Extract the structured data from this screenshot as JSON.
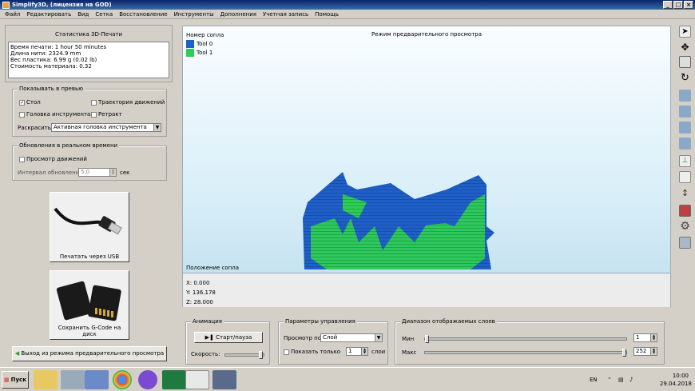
{
  "window": {
    "title": "Simplify3D, (лицензия на GOD)",
    "buttons": [
      "_",
      "□",
      "×"
    ]
  },
  "menu": [
    "Файл",
    "Редактировать",
    "Вид",
    "Сетка",
    "Восстановление",
    "Инструменты",
    "Дополнения",
    "Учетная запись",
    "Помощь"
  ],
  "stats": {
    "title": "Статистика 3D-Печати",
    "lines": [
      "Время печати: 1 hour 50 minutes",
      "Длина нити: 2324.9 mm",
      "Вес пластика: 6.99 g (0.02 lb)",
      "Стоимость материала: 0.32"
    ]
  },
  "show_in_preview": {
    "title": "Показывать в превью",
    "bed": "Стол",
    "travel": "Траектория движений",
    "toolhead": "Головка инструмента",
    "retract": "Ретракт",
    "color_label": "Раскрасить",
    "color_value": "Активная головка инструмента"
  },
  "realtime": {
    "title": "Обновления в реальном времени",
    "movement": "Просмотр движений",
    "interval_label": "Интервал обновления",
    "interval_value": "5,0",
    "interval_unit": "сек"
  },
  "print_usb": "Печатать через USB",
  "save_gcode": "Сохранить G-Code на диск",
  "exit_preview": "Выход из режима предварительного просмотра",
  "viewport": {
    "legend_title": "Номер сопла",
    "legend": [
      {
        "name": "Tool 0",
        "color": "#1f5fc8"
      },
      {
        "name": "Tool 1",
        "color": "#2ecc55"
      }
    ],
    "mode": "Режим предварительного просмотра",
    "nozzle_pos": "Положение сопла"
  },
  "coords": {
    "x": "X: 0.000",
    "y": "Y: 136.178",
    "z": "Z: 28.000"
  },
  "animation": {
    "title": "Анимация",
    "play": "Старт/пауза",
    "speed": "Скорость:",
    "speed_level": 1.0
  },
  "control": {
    "title": "Параметры управления",
    "view_by": "Просмотр по",
    "view_by_value": "Слой",
    "only": "Показать только",
    "only_value": "1",
    "layers": "слои"
  },
  "layer_range": {
    "title": "Диапазон отображаемых слоев",
    "min_label": "Мин",
    "min_value": "1",
    "max_label": "Макс",
    "max_value": "252"
  },
  "taskbar": {
    "start": "Пуск",
    "lang": "EN",
    "time": "10:00",
    "date": "29.04.2018"
  },
  "colors": {
    "tool0": "#1f5fc8",
    "tool1": "#2ecc55"
  }
}
